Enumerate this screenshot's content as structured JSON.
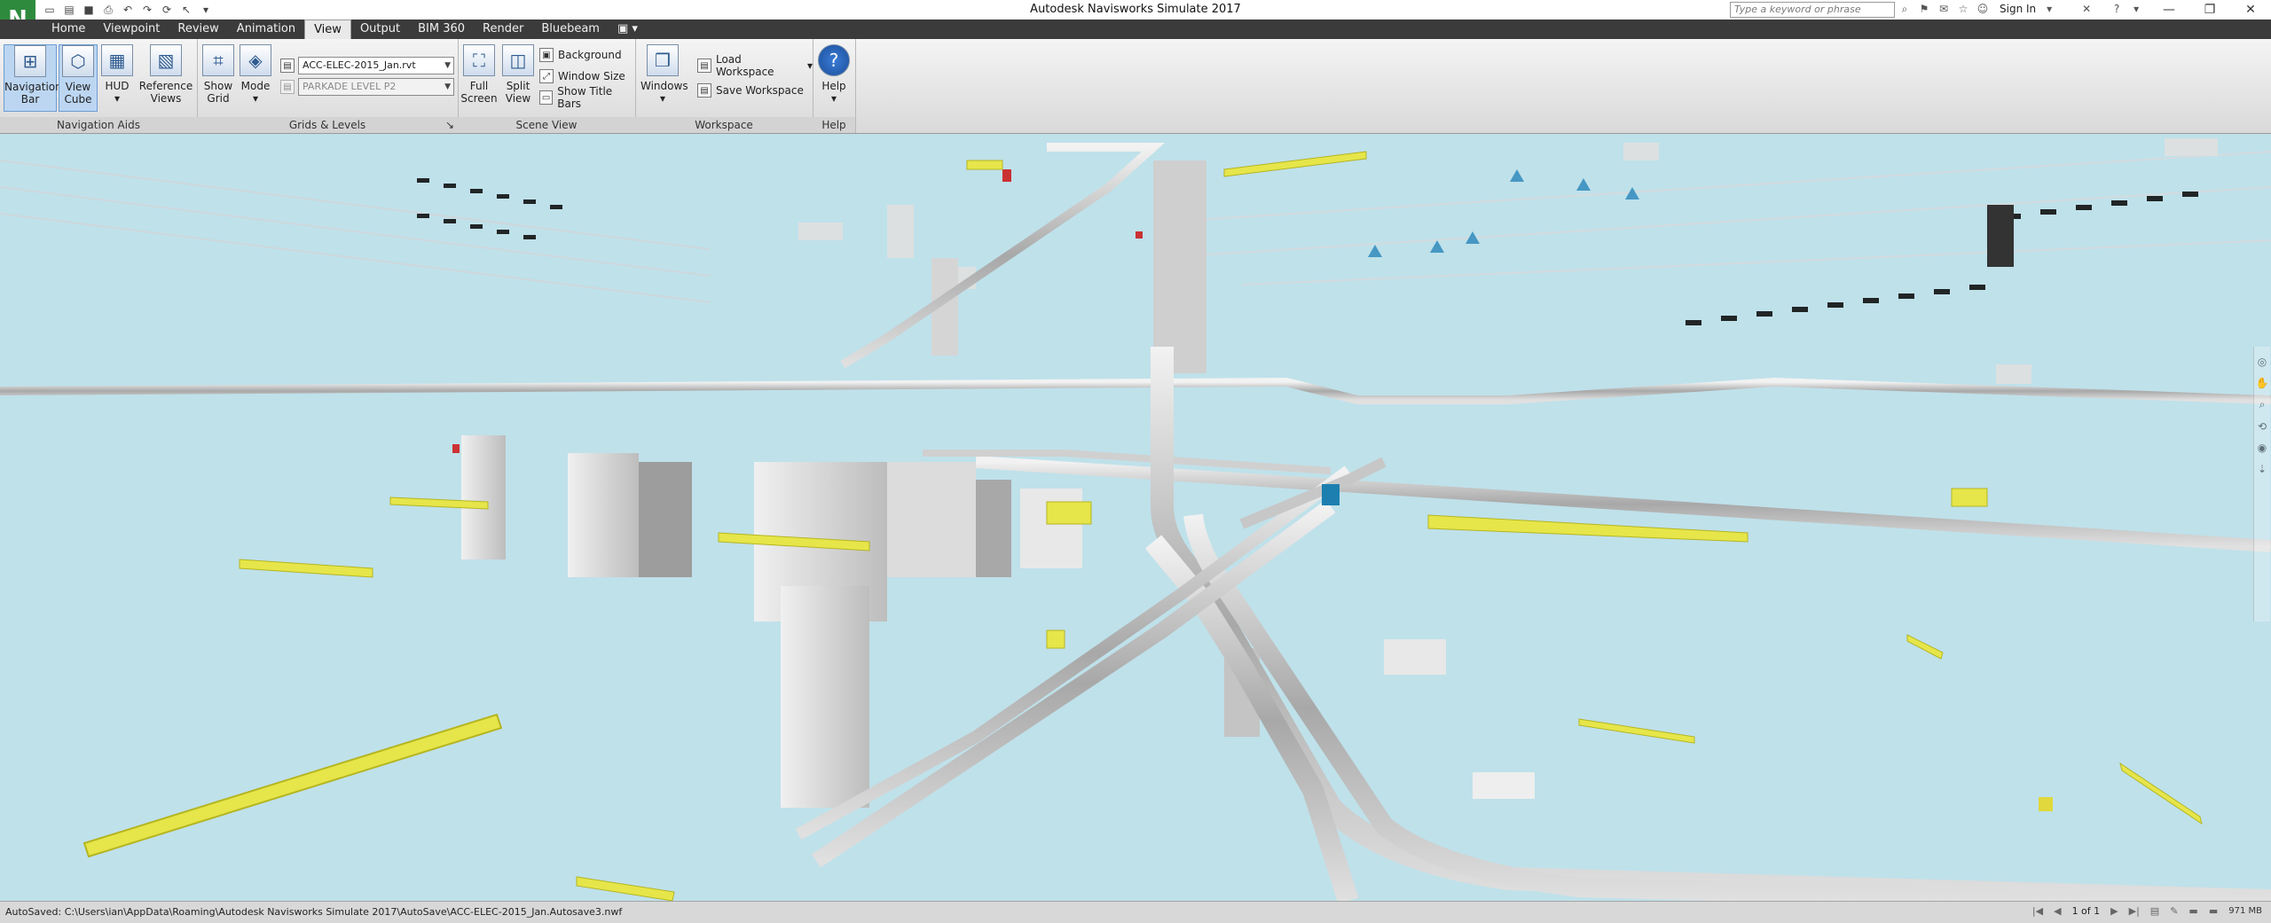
{
  "window": {
    "title": "Autodesk Navisworks Simulate 2017",
    "logo_letter": "N",
    "search_placeholder": "Type a keyword or phrase",
    "sign_in": "Sign In"
  },
  "tabs": [
    "Home",
    "Viewpoint",
    "Review",
    "Animation",
    "View",
    "Output",
    "BIM 360",
    "Render",
    "Bluebeam"
  ],
  "active_tab": "View",
  "ribbon": {
    "navigation_aids": {
      "title": "Navigation Aids",
      "navigation_bar": "Navigation Bar",
      "view_cube": "View Cube",
      "hud": "HUD",
      "reference_views": "Reference Views"
    },
    "grids_levels": {
      "title": "Grids & Levels",
      "show_grid": "Show Grid",
      "mode": "Mode",
      "model_file": "ACC-ELEC-2015_Jan.rvt",
      "level": "PARKADE LEVEL P2"
    },
    "scene_view": {
      "title": "Scene View",
      "full_screen": "Full Screen",
      "split_view": "Split View",
      "background": "Background",
      "window_size": "Window Size",
      "show_title_bars": "Show Title Bars"
    },
    "workspace": {
      "title": "Workspace",
      "windows": "Windows",
      "load_workspace": "Load Workspace",
      "save_workspace": "Save Workspace"
    },
    "help": {
      "title": "Help",
      "help": "Help"
    }
  },
  "status": {
    "autosave": "AutoSaved: C:\\Users\\ian\\AppData\\Roaming\\Autodesk Navisworks Simulate 2017\\AutoSave\\ACC-ELEC-2015_Jan.Autosave3.nwf",
    "page": "1 of 1",
    "memory": "971 MB"
  },
  "colors": {
    "sky": "#bfe1ea",
    "conduit": "#c9c9c9",
    "tray": "#e6e64a",
    "ribbon_tab_bar": "#3b3b3b",
    "logo": "#2e8b3d"
  },
  "icons": {
    "navigation_bar": "compass-icon",
    "view_cube": "cube-icon",
    "hud": "hud-icon",
    "reference_views": "map-icon",
    "show_grid": "grid-icon",
    "mode": "mode-icon",
    "full_screen": "fullscreen-icon",
    "split_view": "split-icon",
    "windows": "windows-icon",
    "help": "help-icon"
  }
}
